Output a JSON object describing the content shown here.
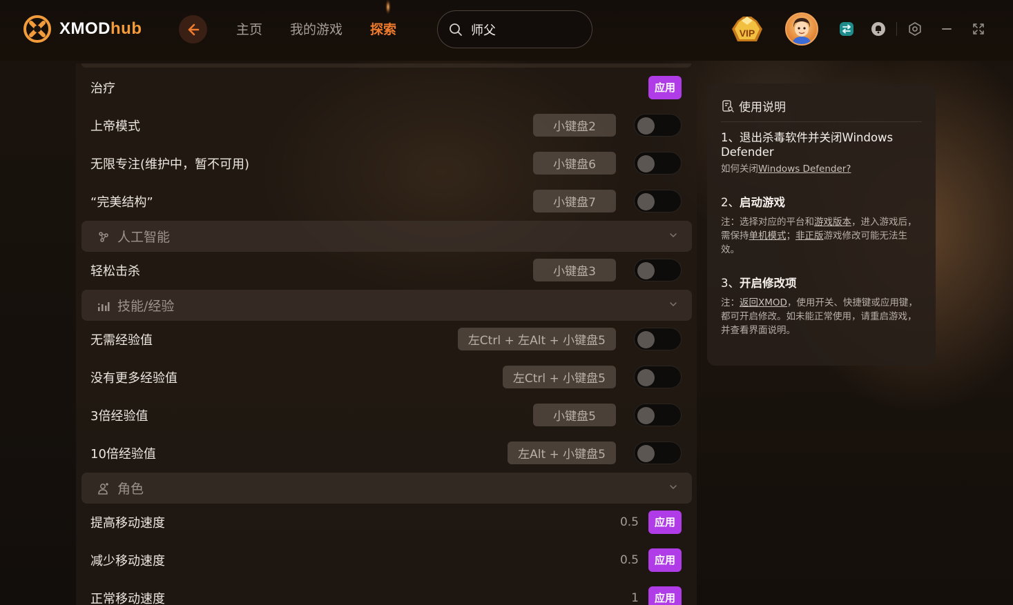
{
  "app": {
    "logo_text_a": "XMOD",
    "logo_text_b": "hub",
    "brand_color": "#f39c3b"
  },
  "nav": {
    "items": [
      {
        "label": "主页",
        "active": false
      },
      {
        "label": "我的游戏",
        "active": false
      },
      {
        "label": "探索",
        "active": true
      }
    ]
  },
  "search": {
    "value": "师父",
    "placeholder": ""
  },
  "header_icons": [
    "vip-badge-icon",
    "user-avatar",
    "transfer-icon",
    "notification-icon",
    "settings-icon",
    "minimize-icon",
    "fullscreen-icon"
  ],
  "mods": {
    "rows": [
      {
        "label": "治疗",
        "action": "apply",
        "apply_label": "应用"
      },
      {
        "label": "上帝模式",
        "hotkey": "小键盘2",
        "toggle": false
      },
      {
        "label": "无限专注(维护中，暂不可用)",
        "hotkey": "小键盘6",
        "toggle": false
      },
      {
        "label": "“完美结构”",
        "hotkey": "小键盘7",
        "toggle": false
      },
      {
        "section": "人工智能",
        "icon": "ai-icon"
      },
      {
        "label": "轻松击杀",
        "hotkey": "小键盘3",
        "toggle": false
      },
      {
        "section": "技能/经验",
        "icon": "skill-chart-icon"
      },
      {
        "label": "无需经验值",
        "hotkey": "左Ctrl + 左Alt + 小键盘5",
        "toggle": false
      },
      {
        "label": "没有更多经验值",
        "hotkey": "左Ctrl + 小键盘5",
        "toggle": false
      },
      {
        "label": "3倍经验值",
        "hotkey": "小键盘5",
        "toggle": false
      },
      {
        "label": "10倍经验值",
        "hotkey": "左Alt + 小键盘5",
        "toggle": false
      },
      {
        "section": "角色",
        "icon": "character-icon"
      },
      {
        "label": "提高移动速度",
        "value": "0.5",
        "apply_label": "应用"
      },
      {
        "label": "减少移动速度",
        "value": "0.5",
        "apply_label": "应用"
      },
      {
        "label": "正常移动速度",
        "value": "1",
        "apply_label": "应用"
      }
    ]
  },
  "instructions": {
    "title": "使用说明",
    "step1_title": "1、退出杀毒软件并关闭Windows Defender",
    "step1_note_prefix": "如何关闭",
    "step1_note_link": "Windows Defender?",
    "step2_title_num": "2、",
    "step2_title": "启动游戏",
    "step2_note_a": "注：选择对应的平台和",
    "step2_note_link1": "游戏版本",
    "step2_note_b": "，进入游戏后，需保持",
    "step2_note_link2": "单机模式",
    "step2_note_c": "；",
    "step2_note_link3": "非正版",
    "step2_note_d": "游戏修改可能无法生效。",
    "step3_title_num": "3、",
    "step3_title": "开启修改项",
    "step3_note_a": "注：",
    "step3_note_link": "返回XMOD",
    "step3_note_b": "，使用开关、快捷键或应用键，都可开启修改。如未能正常使用，请重启游戏，并查看界面说明。"
  },
  "colors": {
    "accent_orange": "#f07b2c",
    "apply_purple": "#b03ce8"
  }
}
